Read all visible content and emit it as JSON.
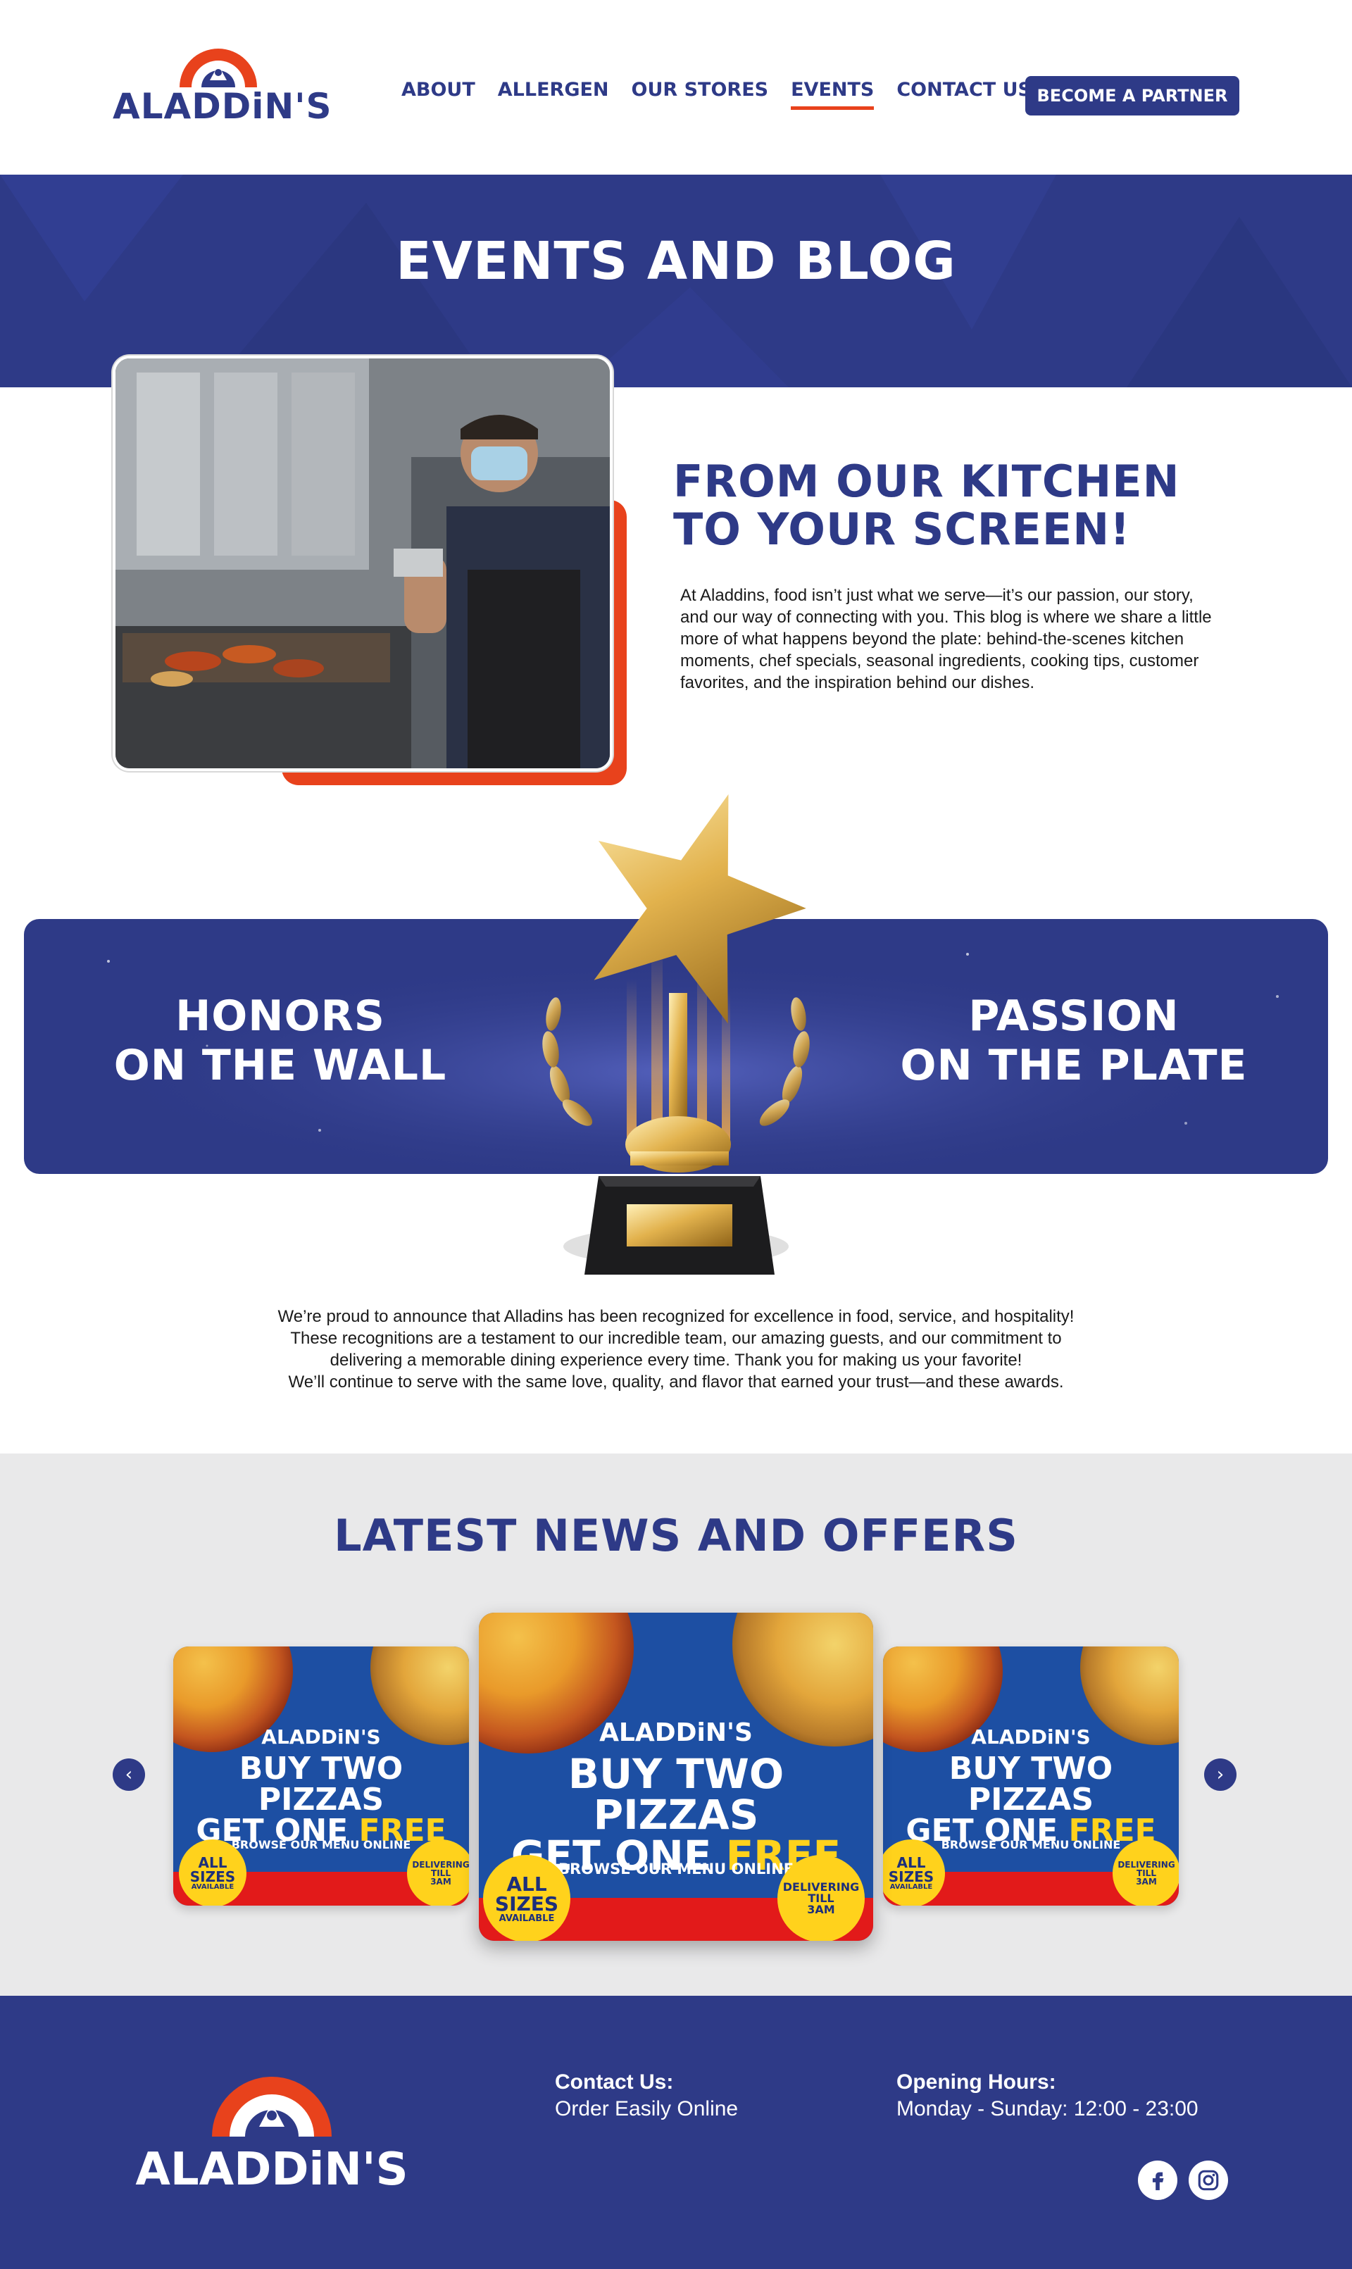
{
  "brand": {
    "name": "ALADDiN'S"
  },
  "nav": {
    "items": [
      "About",
      "Allergen",
      "Our Stores",
      "Events",
      "Contact Us"
    ],
    "active": "Events",
    "partner_button": "Become a Partner"
  },
  "hero": {
    "title": "Events and Blog"
  },
  "intro": {
    "title_line1": "From our kitchen",
    "title_line2": "to your screen!",
    "body": "At Aladdins, food isn’t just what we serve—it’s our passion, our story, and our way of connecting with you. This blog is where we share a little more of what happens beyond the plate: behind-the-scenes kitchen moments, chef specials, seasonal ingredients, cooking tips, customer favorites, and the inspiration behind our dishes."
  },
  "awards": {
    "left_line1": "Honors",
    "left_line2": "on the wall",
    "right_line1": "Passion",
    "right_line2": "on the plate",
    "text_line1": "We’re proud to announce that Alladins has been recognized for excellence in food, service, and hospitality!",
    "text_line2": "These recognitions are a testament to our incredible team, our amazing guests, and our commitment to",
    "text_line3": "delivering a memorable dining experience every time. Thank you for making us your favorite!",
    "text_line4": "We’ll continue to serve with the same love, quality, and flavor that earned your trust—and these awards."
  },
  "news": {
    "title": "Latest news and offers",
    "cards": [
      {
        "brand": "ALADDiN'S",
        "line1": "BUY TWO PIZZAS",
        "line2a": "GET ONE ",
        "line2b": "FREE",
        "browse": "BROWSE OUR MENU ONLINE",
        "badge_left": [
          "ALL",
          "SIZES",
          "AVAILABLE"
        ],
        "badge_right": [
          "DELIVERING",
          "TILL",
          "3AM"
        ]
      },
      {
        "brand": "ALADDiN'S",
        "line1": "BUY TWO PIZZAS",
        "line2a": "GET ONE ",
        "line2b": "FREE",
        "browse": "BROWSE OUR MENU ONLINE",
        "badge_left": [
          "ALL",
          "SIZES",
          "AVAILABLE"
        ],
        "badge_right": [
          "DELIVERING",
          "TILL",
          "3AM"
        ]
      },
      {
        "brand": "ALADDiN'S",
        "line1": "BUY TWO PIZZAS",
        "line2a": "GET ONE ",
        "line2b": "FREE",
        "browse": "BROWSE OUR MENU ONLINE",
        "badge_left": [
          "ALL",
          "SIZES",
          "AVAILABLE"
        ],
        "badge_right": [
          "DELIVERING",
          "TILL",
          "3AM"
        ]
      }
    ],
    "prev_icon": "chevron-left-icon",
    "next_icon": "chevron-right-icon"
  },
  "footer": {
    "brand": "ALADDiN'S",
    "contact_label": "Contact Us:",
    "contact_value": "Order Easily Online",
    "hours_label": "Opening Hours:",
    "hours_value": "Monday - Sunday: 12:00 - 23:00",
    "social": [
      "facebook-icon",
      "instagram-icon"
    ]
  },
  "colors": {
    "primary": "#2e3a87",
    "accent": "#e8421c",
    "news_bg": "#e9e9ea",
    "offer_yellow": "#ffd21c"
  }
}
